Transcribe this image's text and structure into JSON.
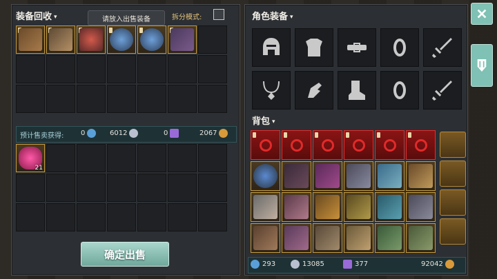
{
  "recycle": {
    "title": "装备回收",
    "tab_label": "请放入出售装备",
    "split_mode_label": "拆分模式:",
    "estimate_label": "预计售卖获得:",
    "estimate_values": [
      "0",
      "6012",
      "0",
      "2067"
    ],
    "sell_button": "确定出售",
    "sell_item_count": "21"
  },
  "character": {
    "title": "角色装备",
    "slots": [
      "helmet-icon",
      "armor-icon",
      "belt-icon",
      "ring-icon",
      "sword-icon",
      "necklace-icon",
      "gauntlet-icon",
      "boots-icon",
      "ring-icon",
      "sword-icon"
    ]
  },
  "backpack": {
    "title": "背包",
    "resources": [
      "293",
      "13085",
      "377",
      "92042"
    ]
  },
  "colors": {
    "accent": "#7fc1b4",
    "item_border": "#c79a3b",
    "selected_red": "#e03030"
  }
}
